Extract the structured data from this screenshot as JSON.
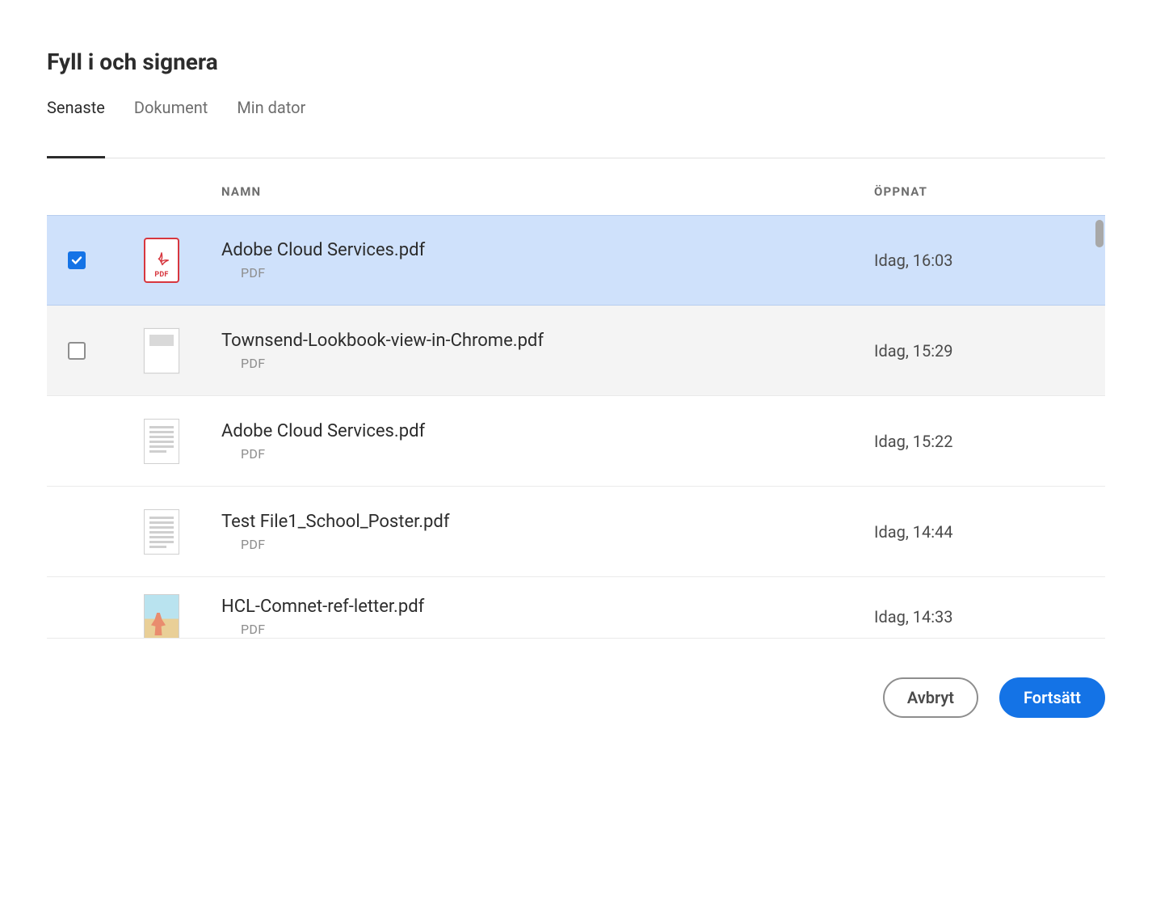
{
  "title": "Fyll i och signera",
  "tabs": [
    {
      "label": "Senaste",
      "active": true
    },
    {
      "label": "Dokument",
      "active": false
    },
    {
      "label": "Min dator",
      "active": false
    }
  ],
  "columns": {
    "name": "NAMN",
    "opened": "ÖPPNAT"
  },
  "files": [
    {
      "name": "Adobe Cloud Services.pdf",
      "type": "PDF",
      "opened": "Idag, 16:03",
      "selected": true,
      "hover": false,
      "thumb": "pdf-icon",
      "showCheckbox": true
    },
    {
      "name": "Townsend-Lookbook-view-in-Chrome.pdf",
      "type": "PDF",
      "opened": "Idag, 15:29",
      "selected": false,
      "hover": true,
      "thumb": "doc",
      "showCheckbox": true
    },
    {
      "name": "Adobe Cloud Services.pdf",
      "type": "PDF",
      "opened": "Idag, 15:22",
      "selected": false,
      "hover": false,
      "thumb": "lines",
      "showCheckbox": false
    },
    {
      "name": "Test File1_School_Poster.pdf",
      "type": "PDF",
      "opened": "Idag, 14:44",
      "selected": false,
      "hover": false,
      "thumb": "lines",
      "showCheckbox": false
    },
    {
      "name": "HCL-Comnet-ref-letter.pdf",
      "type": "PDF",
      "opened": "Idag, 14:33",
      "selected": false,
      "hover": false,
      "thumb": "image",
      "showCheckbox": false
    }
  ],
  "buttons": {
    "cancel": "Avbryt",
    "continue": "Fortsätt"
  },
  "icons": {
    "pdf_label": "PDF"
  }
}
